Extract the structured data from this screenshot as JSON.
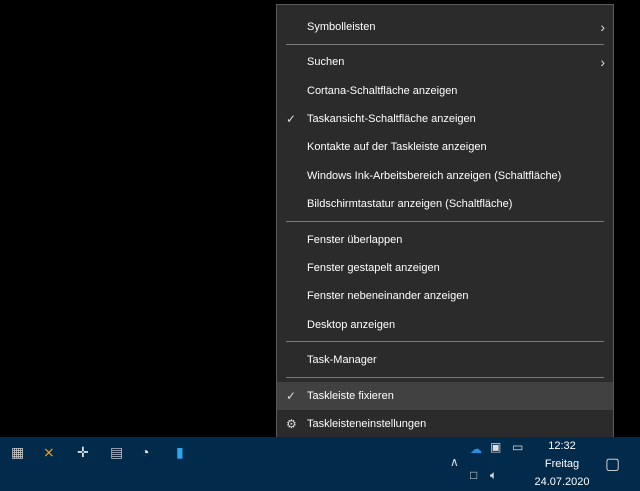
{
  "menu": {
    "symbolleisten": "Symbolleisten",
    "suchen": "Suchen",
    "cortana": "Cortana-Schaltfläche anzeigen",
    "taskansicht": "Taskansicht-Schaltfläche anzeigen",
    "kontakte": "Kontakte auf der Taskleiste anzeigen",
    "ink": "Windows Ink-Arbeitsbereich anzeigen (Schaltfläche)",
    "tastatur": "Bildschirmtastatur anzeigen (Schaltfläche)",
    "ueberlappen": "Fenster überlappen",
    "gestapelt": "Fenster gestapelt anzeigen",
    "nebeneinander": "Fenster nebeneinander anzeigen",
    "desktop": "Desktop anzeigen",
    "taskmanager": "Task-Manager",
    "fixieren": "Taskleiste fixieren",
    "einstellungen": "Taskleisteneinstellungen"
  },
  "clock": {
    "time": "12:32",
    "day": "Freitag",
    "date": "24.07.2020"
  }
}
